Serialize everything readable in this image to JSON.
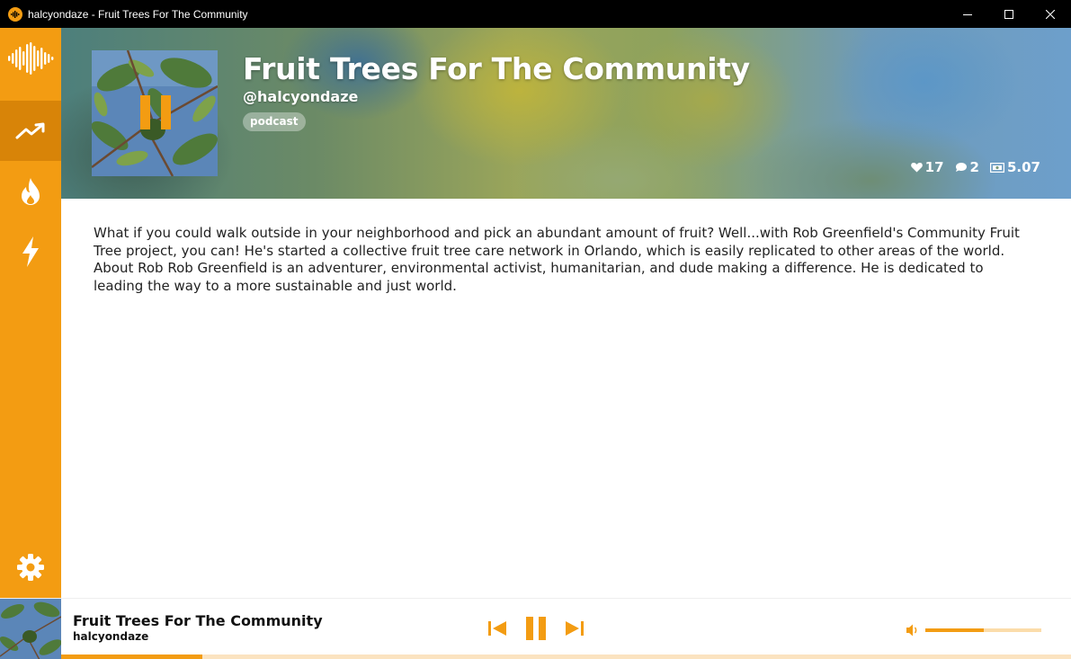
{
  "window": {
    "title": "halcyondaze - Fruit Trees For The Community",
    "controls": [
      "minimize",
      "maximize",
      "close"
    ]
  },
  "sidebar": {
    "logo_icon": "soundwave-icon",
    "items": [
      {
        "icon": "trending-icon",
        "active": true
      },
      {
        "icon": "flame-icon",
        "active": false
      },
      {
        "icon": "lightning-icon",
        "active": false
      }
    ],
    "settings_icon": "gear-icon",
    "accent_color": "#f39c12"
  },
  "episode": {
    "title": "Fruit Trees For The Community",
    "author": "@halcyondaze",
    "tag": "podcast",
    "likes": "17",
    "comments": "2",
    "earnings": "5.07",
    "description": "What if you could walk outside in your neighborhood and pick an abundant amount of fruit? Well...with Rob Greenfield's Community Fruit Tree project, you can! He's started a collective fruit tree care network in Orlando, which is easily replicated to other areas of the world. About Rob Rob Greenfield is an adventurer, environmental activist, humanitarian, and dude making a difference. He is dedicated to leading the way to a more sustainable and just world."
  },
  "player": {
    "title": "Fruit Trees For The Community",
    "author": "halcyondaze",
    "state": "playing",
    "volume_percent": 50,
    "progress_percent": 14
  }
}
